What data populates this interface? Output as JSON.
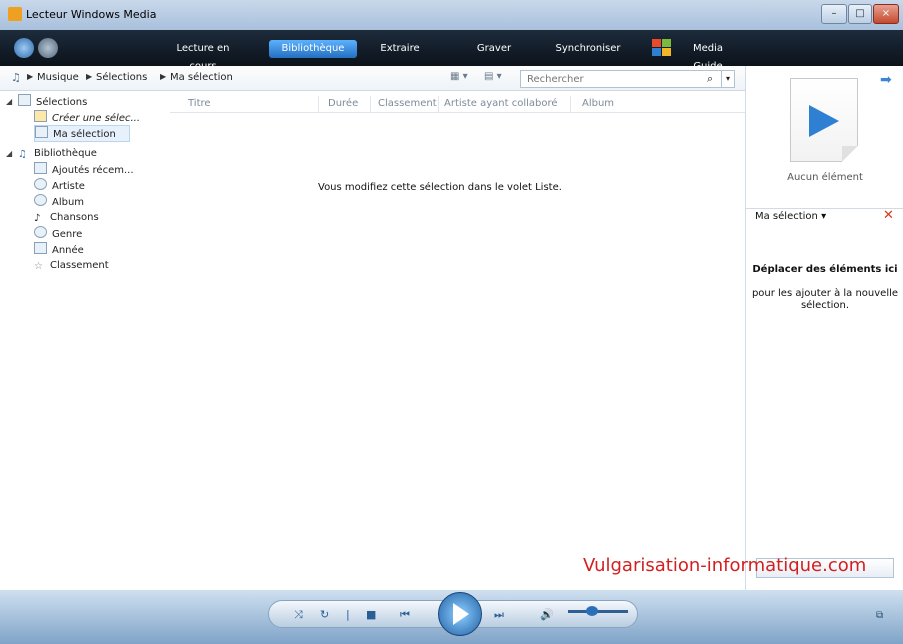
{
  "window": {
    "title": "Lecteur Windows Media",
    "minimize": "–",
    "maximize": "□",
    "close": "×"
  },
  "nav": {
    "tabs": [
      "Lecture en cours",
      "Bibliothèque",
      "Extraire",
      "Graver",
      "Synchroniser",
      "Media Guide"
    ],
    "active_tab": "Bibliothèque"
  },
  "breadcrumb": [
    "Musique",
    "Sélections",
    "Ma sélection"
  ],
  "search": {
    "placeholder": "Rechercher"
  },
  "tree": {
    "selections_label": "Sélections",
    "create_label": "Créer une sélec...",
    "my_selection_label": "Ma sélection",
    "library_label": "Bibliothèque",
    "items": [
      "Ajoutés récem...",
      "Artiste",
      "Album",
      "Chansons",
      "Genre",
      "Année",
      "Classement"
    ]
  },
  "columns": [
    "Titre",
    "Durée",
    "Classement",
    "Artiste ayant collaboré",
    "Album"
  ],
  "content": {
    "empty_message": "Vous modifiez cette sélection dans le volet Liste."
  },
  "right_pane": {
    "no_item": "Aucun élément",
    "list_name": "Ma sélection",
    "drop_title": "Déplacer des éléments ici",
    "drop_hint": "pour les ajouter à la nouvelle sélection."
  },
  "watermark": "Vulgarisation-informatique.com",
  "colors": {
    "accent": "#2a6fbd",
    "nav_bg": "#0e1620",
    "close_red": "#d23a1a",
    "watermark": "#d22020"
  },
  "icons": [
    "music-note-icon",
    "arrow-right-icon",
    "search-icon",
    "play-icon",
    "stop-icon",
    "shuffle-icon",
    "repeat-icon",
    "volume-icon"
  ]
}
